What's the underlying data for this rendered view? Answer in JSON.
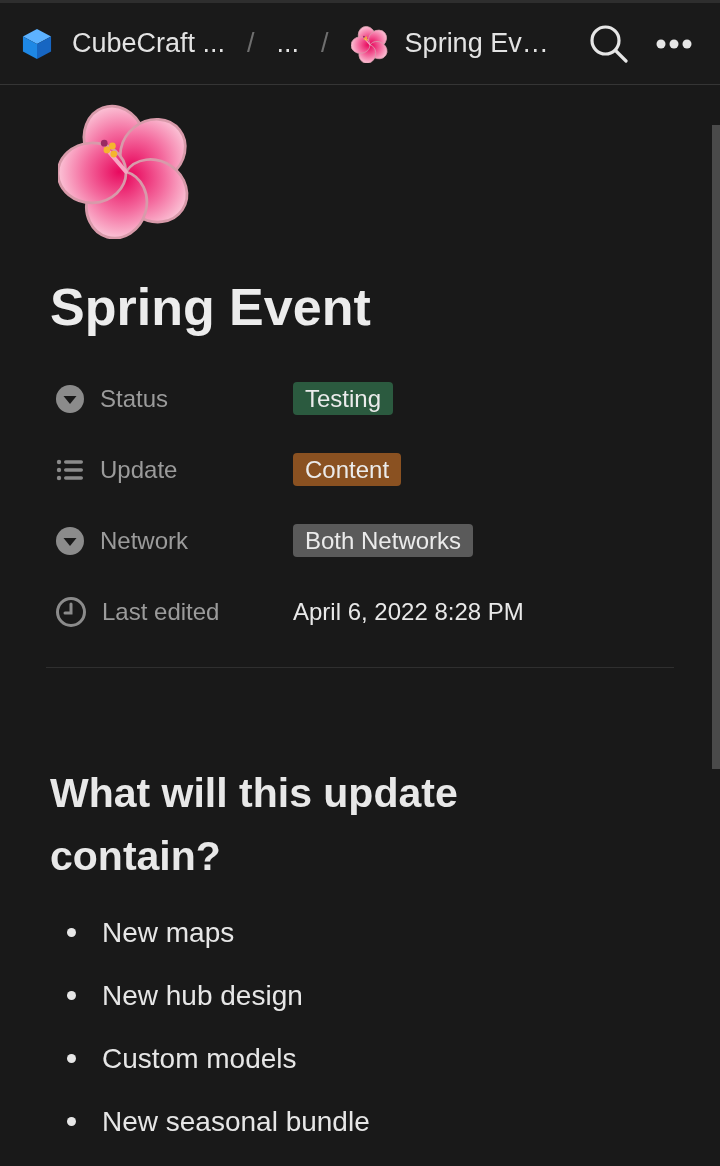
{
  "breadcrumb": [
    {
      "kind": "workspace",
      "label": "CubeCraft ..."
    },
    {
      "kind": "separator",
      "label": "/"
    },
    {
      "kind": "collapsed",
      "label": "..."
    },
    {
      "kind": "separator",
      "label": "/"
    },
    {
      "kind": "page",
      "label": "Spring Ev…"
    }
  ],
  "page": {
    "title": "Spring Event",
    "properties": [
      {
        "kind": "select",
        "name": "Status",
        "tags": [
          {
            "label": "Testing",
            "color": "#2b5a3f"
          }
        ]
      },
      {
        "kind": "multi_select",
        "name": "Update",
        "tags": [
          {
            "label": "Content",
            "color": "#8a5121"
          }
        ]
      },
      {
        "kind": "select",
        "name": "Network",
        "tags": [
          {
            "label": "Both Networks",
            "color": "#5a5a5a"
          }
        ]
      },
      {
        "kind": "last_edited",
        "name": "Last edited",
        "value": "April 6, 2022 8:28 PM"
      }
    ],
    "heading": "What will this update contain?",
    "bullets": [
      "New maps",
      "New hub design",
      "Custom models",
      "New seasonal bundle"
    ]
  }
}
